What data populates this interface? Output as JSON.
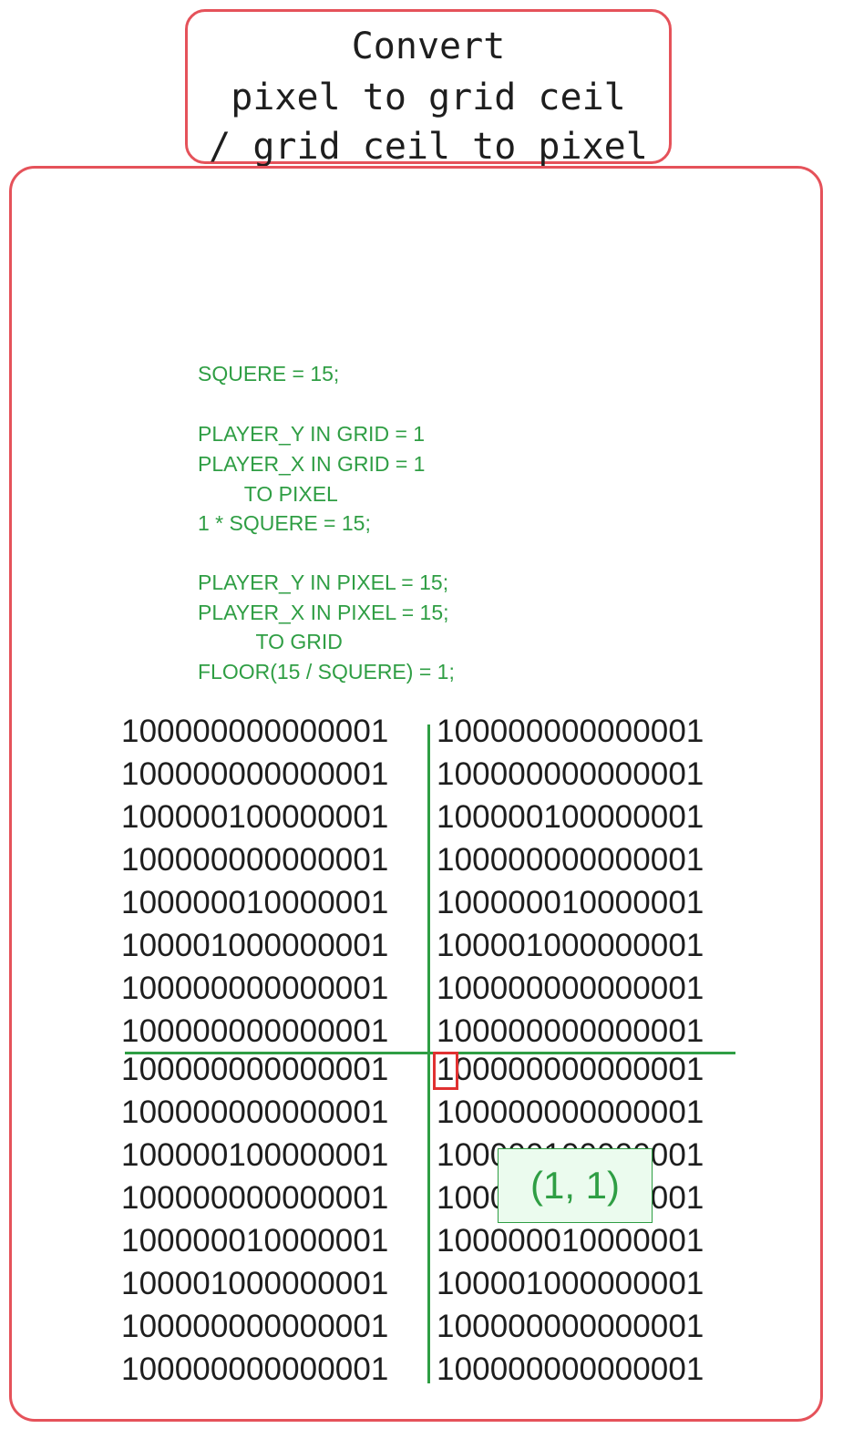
{
  "title": {
    "lines": [
      "Convert",
      "pixel to grid ceil",
      "/ grid ceil to pixel"
    ]
  },
  "code": {
    "lines": [
      "SQUERE = 15;",
      "PLAYER_Y IN GRID = 1",
      "PLAYER_X IN GRID = 1",
      "        TO PIXEL",
      "1 * SQUERE = 15;",
      "PLAYER_Y IN PIXEL = 15;",
      "PLAYER_X IN PIXEL = 15;",
      "          TO GRID",
      "FLOOR(15 / SQUERE) = 1;"
    ]
  },
  "grid": {
    "rows": [
      "100000000000001",
      "100000000000001",
      "100000100000001",
      "100000000000001",
      "100000010000001",
      "100001000000001",
      "100000000000001",
      "100000000000001",
      "100000000000001",
      "100000000000001",
      "100000100000001",
      "100000000000001",
      "100000010000001",
      "100001000000001",
      "100000000000001",
      "100000000000001"
    ],
    "right_rows": [
      "100000000000001",
      "100000000000001",
      "100000100000001",
      "100000000000001",
      "100000010000001",
      "100001000000001",
      "100000000000001",
      "100000000000001",
      "100000000000001",
      "100000000000001",
      "100000100000001",
      "100000000000001",
      "100000010000001",
      "100001000000001",
      "100000000000001",
      "100000000000001"
    ]
  },
  "coordinate_label": "(1, 1)",
  "colors": {
    "frame": "#e5525a",
    "code": "#2f9e44",
    "axes": "#2f9e44",
    "highlight": "#e03131",
    "label_fill": "#ebfbee"
  }
}
